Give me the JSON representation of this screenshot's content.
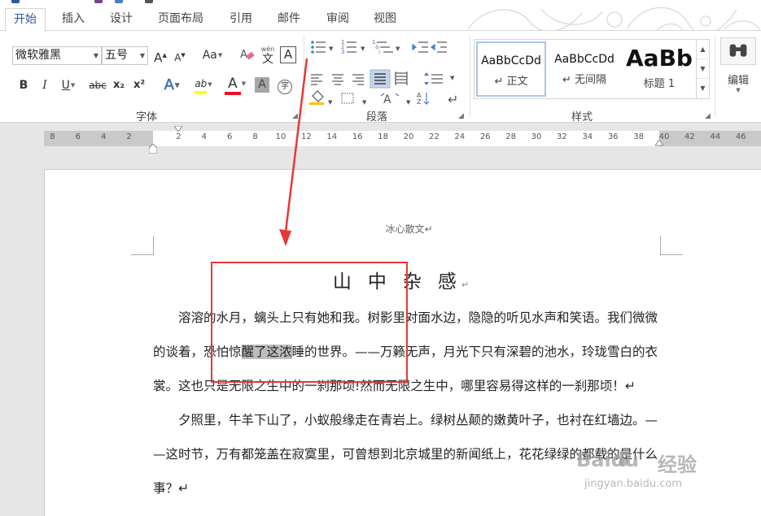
{
  "tabs": [
    {
      "label": "开始",
      "active": true
    },
    {
      "label": "插入"
    },
    {
      "label": "设计"
    },
    {
      "label": "页面布局"
    },
    {
      "label": "引用"
    },
    {
      "label": "邮件"
    },
    {
      "label": "审阅"
    },
    {
      "label": "视图"
    }
  ],
  "font_group": {
    "label": "字体",
    "font_name": "微软雅黑",
    "font_size": "五号",
    "grow_label": "A",
    "shrink_label": "A",
    "case_label": "Aa",
    "phonetic_top": "wén",
    "phonetic_bottom": "文",
    "border_char_label": "A",
    "bold": "B",
    "italic": "I",
    "underline": "U",
    "strikethrough": "abc",
    "subscript": "x₂",
    "superscript": "x²",
    "text_effects": "A",
    "highlight": "ab",
    "font_color": "A",
    "char_shading": "A",
    "enclose_char": "字"
  },
  "paragraph_group": {
    "label": "段落"
  },
  "styles_group": {
    "label": "样式",
    "items": [
      {
        "sample": "AaBbCcDd",
        "name": "↵ 正文",
        "selected": true
      },
      {
        "sample": "AaBbCcDd",
        "name": "↵ 无间隔"
      },
      {
        "sample": "AaBb",
        "name": "标题 1"
      }
    ]
  },
  "editing_group": {
    "label": "编辑"
  },
  "ruler": {
    "left_numbers": [
      "8",
      "6",
      "4",
      "2"
    ],
    "right_numbers": [
      "2",
      "4",
      "6",
      "8",
      "10",
      "12",
      "14",
      "16",
      "18",
      "20",
      "22",
      "24",
      "26",
      "28",
      "30",
      "32",
      "34",
      "36",
      "38",
      "40",
      "42",
      "44",
      "46"
    ]
  },
  "document": {
    "header": "冰心散文↵",
    "title": "山中杂感",
    "title_mark": "↵",
    "para1_lines": [
      "　　溶溶的水月，螭头上只有她和我。树影里对面水边，隐隐的听见水声和笑语。我们微微",
      "的谈着，恐怕惊醒了这浓睡的世界。——万籁无声，月光下只有深碧的池水，玲珑雪白的衣",
      "裳。这也只是无限之生中的一刹那顷!然而无限之生中，哪里容易得这样的一刹那顷！↵"
    ],
    "para1_highlight": "醒了这浓",
    "para1_line2_before": "的谈着，恐怕惊",
    "para1_line2_after": "睡的世界。——万籁无声，月光下只有深碧的池水，玲珑雪白的衣",
    "para2_lines": [
      "　　夕照里，牛羊下山了，小蚁般缘走在青岩上。绿树丛颠的嫩黄叶子，也衬在红墙边。—",
      "—这时节，万有都笼盖在寂寞里，可曾想到北京城里的新闻纸上，花花绿绿的都载的是什么",
      "事？↵"
    ]
  },
  "watermark": {
    "brand": "Baidu",
    "text": "经验",
    "url": "jingyan.baidu.com"
  },
  "colors": {
    "accent": "#2b579a",
    "annotation_red": "#e53935",
    "highlight_yellow": "#ffff00",
    "font_color_red": "#e81123",
    "ruler_gray": "#c9c9c9"
  }
}
